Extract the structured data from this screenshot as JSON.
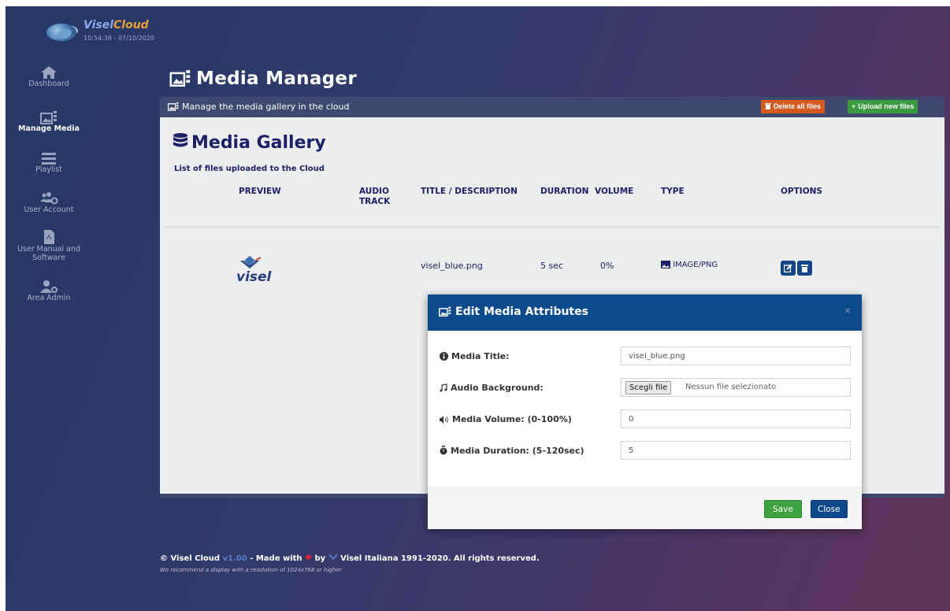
{
  "brand": {
    "name_part1": "Visel",
    "name_part2": "Cloud",
    "clock": "10:54:38 - 07/10/2020"
  },
  "sidebar": {
    "items": [
      {
        "label": "Dashboard",
        "icon": "home-icon",
        "active": false
      },
      {
        "label": "Manage Media",
        "icon": "media-icon",
        "active": true
      },
      {
        "label": "Playlist",
        "icon": "list-icon",
        "active": false
      },
      {
        "label": "User Account",
        "icon": "users-icon",
        "active": false
      },
      {
        "label": "User Manual and Software",
        "icon": "document-icon",
        "active": false
      },
      {
        "label": "Area Admin",
        "icon": "admin-icon",
        "active": false
      }
    ]
  },
  "page": {
    "title": "Media Manager"
  },
  "toolbar": {
    "description": "Manage the media gallery in the cloud",
    "delete_all_label": "Delete all files",
    "upload_label": "Upload new files"
  },
  "gallery": {
    "title": "Media Gallery",
    "subtitle": "List of files uploaded to the Cloud",
    "columns": {
      "preview": "PREVIEW",
      "audio": "AUDIO TRACK",
      "title": "TITLE / DESCRIPTION",
      "duration": "DURATION",
      "volume": "VOLUME",
      "type": "TYPE",
      "options": "OPTIONS"
    },
    "rows": [
      {
        "title": "visel_blue.png",
        "duration": "5 sec",
        "volume": "0%",
        "type": "IMAGE/PNG",
        "logo_text": "visel"
      }
    ]
  },
  "modal": {
    "title": "Edit Media Attributes",
    "close_symbol": "×",
    "fields": {
      "media_title_label": "Media Title:",
      "media_title_value": "visel_blue.png",
      "audio_label": "Audio Background:",
      "file_button": "Scegli file",
      "file_status": "Nessun file selezionato",
      "volume_label": "Media Volume: (0-100%)",
      "volume_value": "0",
      "duration_label": "Media Duration: (5-120sec)",
      "duration_value": "5"
    },
    "save_label": "Save",
    "close_label": "Close"
  },
  "footer": {
    "copyright_prefix": "© Visel Cloud",
    "version": "v1.00",
    "made_with": "- Made with",
    "by": "by",
    "company": "Visel Italiana 1991-2020. All rights reserved.",
    "recommendation": "We recommend a display with a resolution of 1024x768 or higher"
  },
  "colors": {
    "accent_blue": "#0d4a8c",
    "save_green": "#3fa13f",
    "delete_orange": "#d65a1e",
    "gallery_title": "#1d2068"
  }
}
